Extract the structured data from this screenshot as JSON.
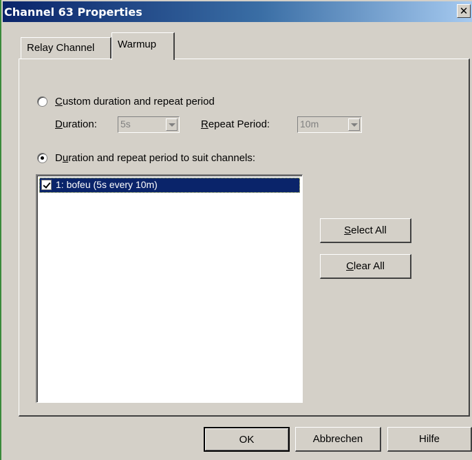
{
  "window": {
    "title": "Channel 63 Properties",
    "close_glyph": "✕"
  },
  "tabs": [
    {
      "label": "Relay Channel",
      "active": false
    },
    {
      "label": "Warmup",
      "active": true
    }
  ],
  "warmup": {
    "custom_option": {
      "mnemonic": "C",
      "rest": "ustom duration and repeat period",
      "selected": false
    },
    "duration": {
      "mnemonic": "D",
      "rest": "uration:",
      "value": "5s"
    },
    "repeat": {
      "mnemonic": "R",
      "rest": "epeat Period:",
      "value": "10m"
    },
    "suit_option": {
      "pre": "D",
      "mnemonic": "u",
      "rest": "ration and repeat period to suit channels:",
      "selected": true
    },
    "channels": [
      {
        "label": "1: bofeu (5s every 10m)",
        "checked": true,
        "selected": true
      }
    ],
    "select_all": {
      "mnemonic": "S",
      "rest": "elect All"
    },
    "clear_all": {
      "mnemonic": "C",
      "rest": "lear All"
    }
  },
  "footer": {
    "ok_label": "OK",
    "cancel_label": "Abbrechen",
    "help_label": "Hilfe"
  },
  "colors": {
    "dialog_bg": "#d4d0c8",
    "title_start": "#0a246a",
    "title_end": "#a6caf0",
    "selection": "#0a246a"
  }
}
